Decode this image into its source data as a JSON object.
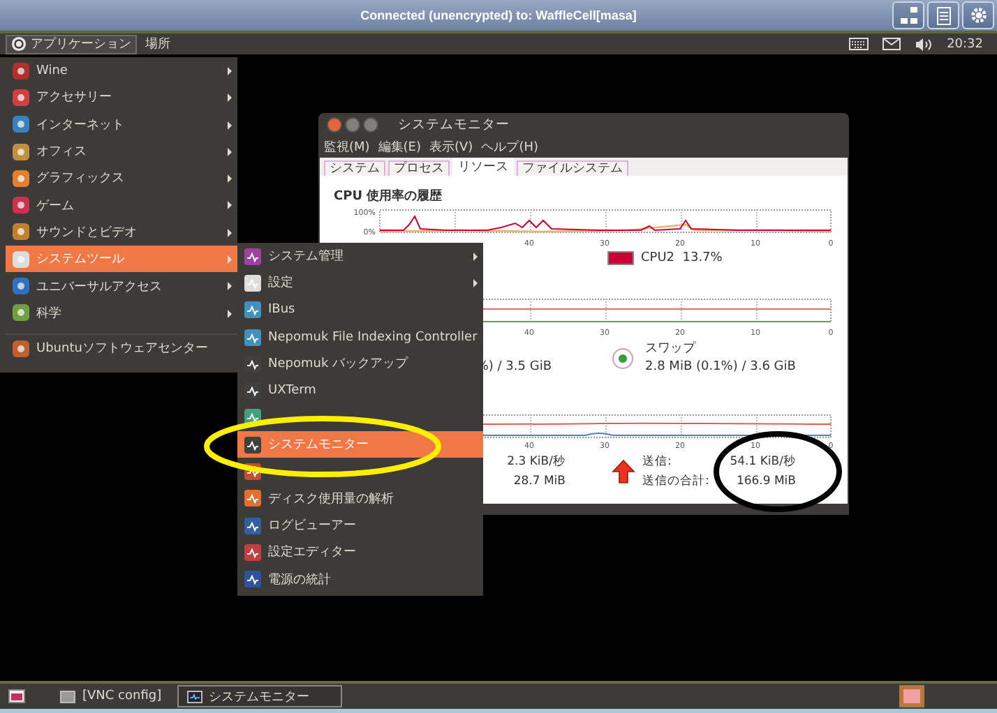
{
  "vnc_window": {
    "title": "Connected (unencrypted) to: WaffleCell[masa]"
  },
  "top_panel": {
    "menus": [
      {
        "label": "アプリケーション",
        "selected": true
      },
      {
        "label": "場所",
        "selected": false
      }
    ],
    "clock": "20:32"
  },
  "app_menu": {
    "items": [
      {
        "label": "Wine",
        "submenu": true,
        "selected": false
      },
      {
        "label": "アクセサリー",
        "submenu": true,
        "selected": false
      },
      {
        "label": "インターネット",
        "submenu": true,
        "selected": false
      },
      {
        "label": "オフィス",
        "submenu": true,
        "selected": false
      },
      {
        "label": "グラフィックス",
        "submenu": true,
        "selected": false
      },
      {
        "label": "ゲーム",
        "submenu": true,
        "selected": false
      },
      {
        "label": "サウンドとビデオ",
        "submenu": true,
        "selected": false
      },
      {
        "label": "システムツール",
        "submenu": true,
        "selected": true
      },
      {
        "label": "ユニバーサルアクセス",
        "submenu": true,
        "selected": false
      },
      {
        "label": "科学",
        "submenu": true,
        "selected": false
      },
      {
        "label": "Ubuntuソフトウェアセンター",
        "submenu": false,
        "selected": false,
        "separator_before": true
      }
    ]
  },
  "submenu": {
    "items": [
      {
        "label": "システム管理",
        "submenu": true,
        "selected": false
      },
      {
        "label": "設定",
        "submenu": true,
        "selected": false
      },
      {
        "label": "IBus",
        "submenu": false,
        "selected": false
      },
      {
        "label": "Nepomuk File Indexing Controller",
        "submenu": false,
        "selected": false
      },
      {
        "label": "Nepomuk バックアップ",
        "submenu": false,
        "selected": false
      },
      {
        "label": "UXTerm",
        "submenu": false,
        "selected": false
      },
      {
        "submenu": false,
        "selected": false
      },
      {
        "label": "システムモニター",
        "submenu": false,
        "selected": true
      },
      {
        "submenu": false,
        "selected": false
      },
      {
        "label": "ディスク使用量の解析",
        "submenu": false,
        "selected": false
      },
      {
        "label": "ログビューアー",
        "submenu": false,
        "selected": false
      },
      {
        "label": "設定エディター",
        "submenu": false,
        "selected": false
      },
      {
        "label": "電源の統計",
        "submenu": false,
        "selected": false
      }
    ]
  },
  "monitor": {
    "title": "システムモニター",
    "menus": [
      "監視(M)",
      "編集(E)",
      "表示(V)",
      "ヘルプ(H)"
    ],
    "tabs": [
      {
        "label": "システム",
        "selected": false
      },
      {
        "label": "プロセス",
        "selected": false
      },
      {
        "label": "リソース",
        "selected": true
      },
      {
        "label": "ファイルシステム",
        "selected": false
      }
    ],
    "cpu": {
      "heading": "CPU 使用率の履歴",
      "yticks": [
        "100%",
        "0%"
      ],
      "xticks": [
        "40",
        "30",
        "20",
        "10",
        "0"
      ],
      "legend": {
        "label": "CPU2  13.7%",
        "color": "#cc0033"
      }
    },
    "memory": {
      "xticks": [
        "40",
        "30",
        "20",
        "10",
        "0"
      ],
      "used": "%) / 3.5 GiB",
      "swap": {
        "label": "スワップ",
        "value": "2.8 MiB (0.1%) / 3.6 GiB"
      }
    },
    "network": {
      "xticks": [
        "40",
        "30",
        "20",
        "10",
        "0"
      ],
      "received_rate": "2.3 KiB/秒",
      "received_total": "28.7 MiB",
      "sent_label": "送信:",
      "sent_rate": "54.1 KiB/秒",
      "sent_total_label": "送信の合計:",
      "sent_total": "166.9 MiB"
    }
  },
  "bottom_panel": {
    "tasks": [
      {
        "label": "[VNC config]",
        "selected": false
      },
      {
        "label": "システムモニター",
        "selected": true
      }
    ]
  }
}
